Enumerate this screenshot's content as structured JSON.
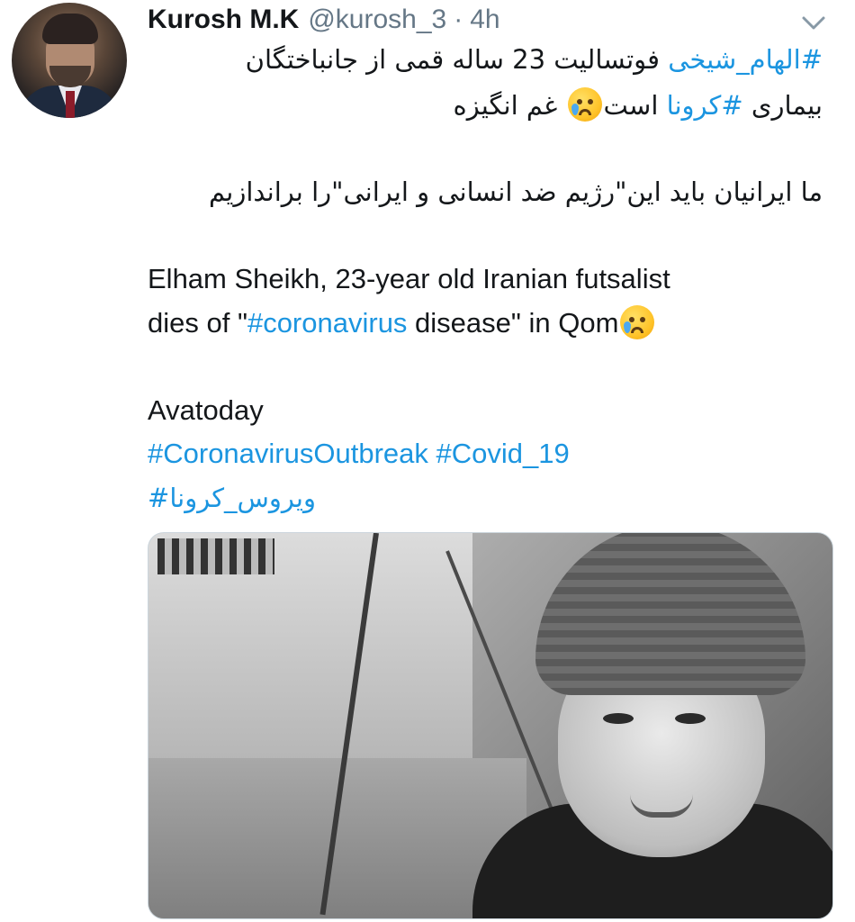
{
  "tweet": {
    "author_name": "Kurosh M.K",
    "handle": "@kurosh_3",
    "separator": "·",
    "time": "4h",
    "lines": {
      "fa1_tag": "#الهام_شیخی",
      "fa1_text": " فوتسالیت 23 ساله قمی از جانباختگان",
      "fa2_text_a": "بیماری ",
      "fa2_tag": "#کرونا",
      "fa2_text_b": " است",
      "fa2_text_c": " غم انگیزه",
      "fa3_text": "ما ایرانیان باید این\"رژیم ضد انسانی و ایرانی\"را براندازیم",
      "en1_text": "Elham Sheikh, 23-year old Iranian futsalist",
      "en2_text_a": "dies of \"",
      "en2_tag": "#coronavirus",
      "en2_text_b": " disease\" in Qom",
      "source_text": "Avatoday",
      "hashtag_a": "#CoronavirusOutbreak",
      "hashtag_b": "#Covid_19",
      "hashtag_fa": "#ویروس_کرونا"
    },
    "emoji": "crying-face-icon",
    "link_color": "#1b95e0",
    "text_color": "#14171a",
    "meta_color": "#657786"
  }
}
